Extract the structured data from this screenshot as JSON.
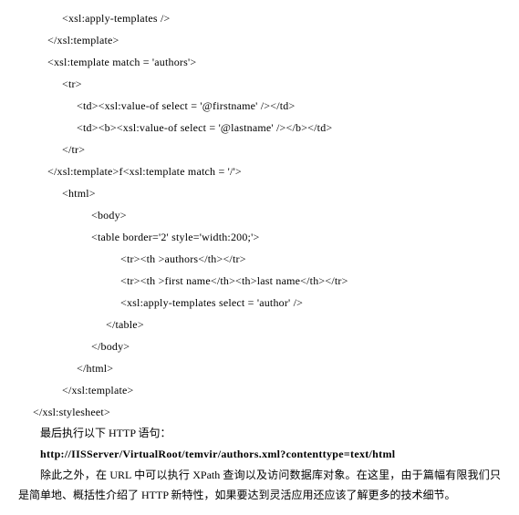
{
  "code": {
    "l1": "<xsl:apply-templates />",
    "l2": "</xsl:template>",
    "l3": "<xsl:template match = 'authors'>",
    "l4": "<tr>",
    "l5": "<td><xsl:value-of select = '@firstname' /></td>",
    "l6": "<td><b><xsl:value-of select = '@lastname' /></b></td>",
    "l7": "</tr>",
    "l8": "</xsl:template>f<xsl:template match = '/'>",
    "l9": "<html>",
    "l10": "<body>",
    "l11": "<table border='2' style='width:200;'>",
    "l12": "<tr><th >authors</th></tr>",
    "l13": "<tr><th >first name</th><th>last name</th></tr>",
    "l14": "<xsl:apply-templates select = 'author' />",
    "l15": "</table>",
    "l16": "</body>",
    "l17": "</html>",
    "l18": "</xsl:template>",
    "l19": "</xsl:stylesheet>"
  },
  "text": {
    "p1": "最后执行以下 HTTP 语句：",
    "url": "http://IISServer/VirtualRoot/temvir/authors.xml?contenttype=text/html",
    "p2": "除此之外，在 URL 中可以执行 XPath 查询以及访问数据库对象。在这里，由于篇幅有限我们只是简单地、概括性介绍了 HTTP 新特性，如果要达到灵活应用还应该了解更多的技术细节。"
  }
}
